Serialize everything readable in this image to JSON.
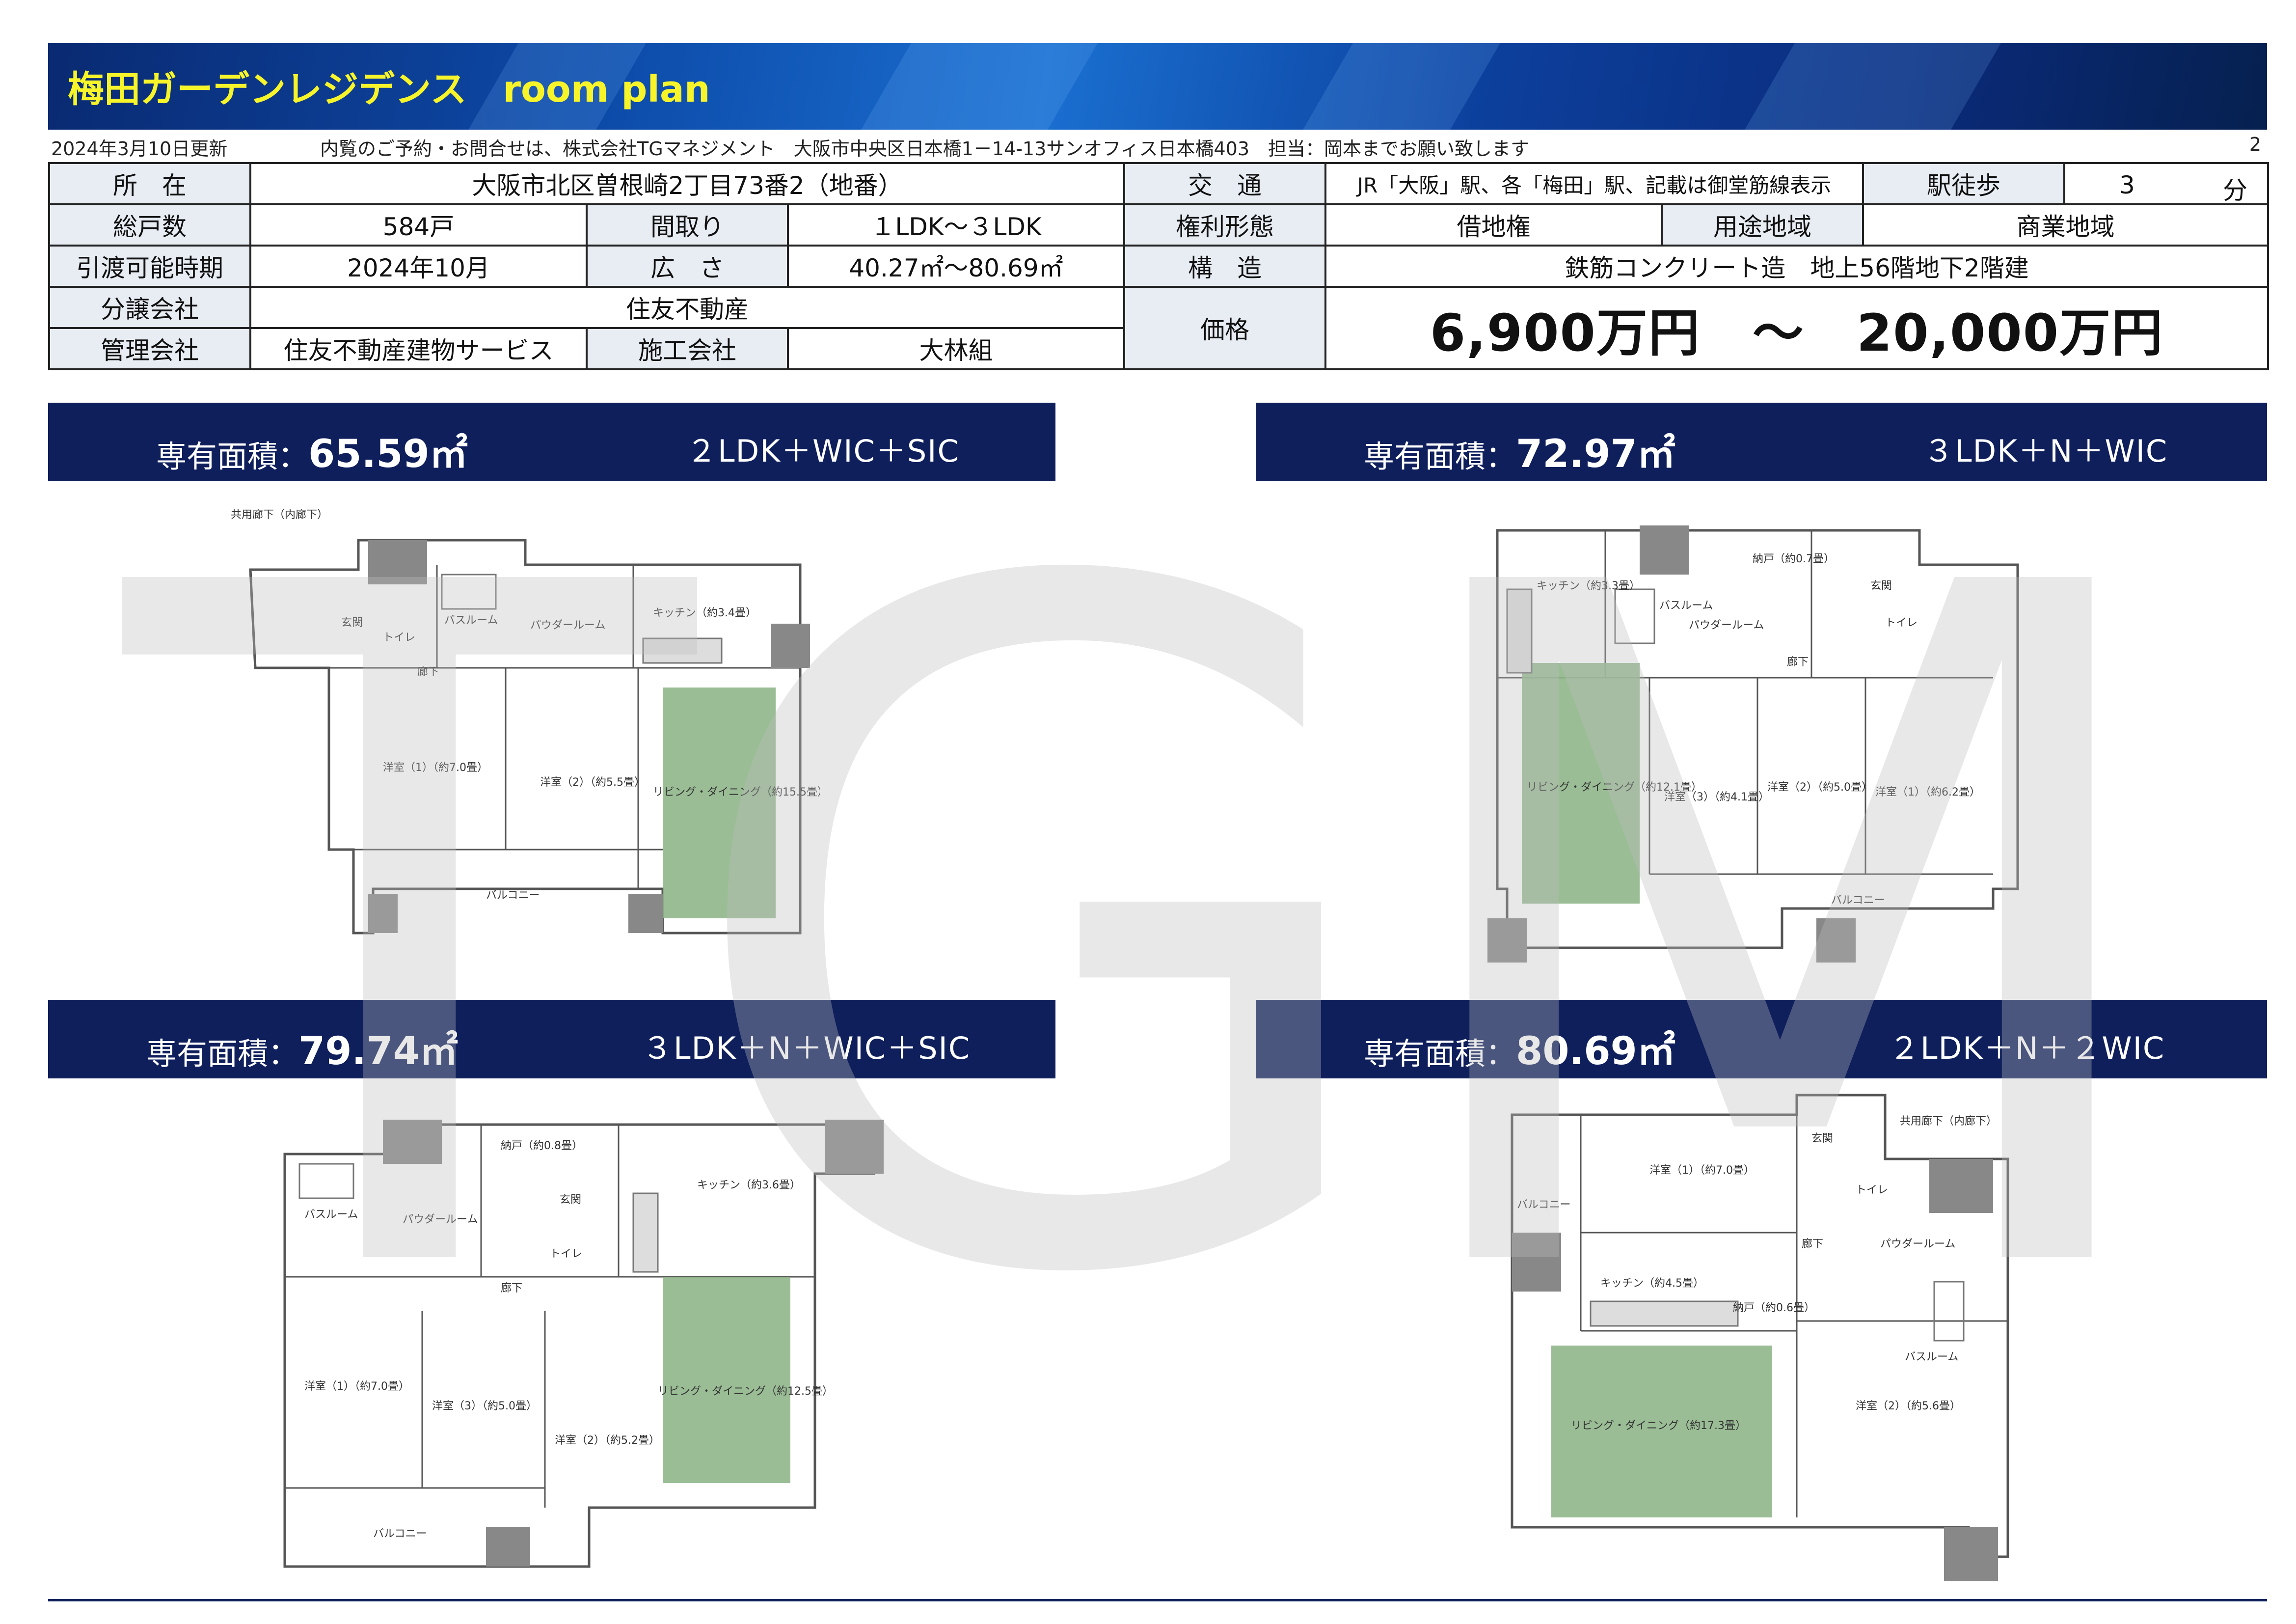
{
  "header": {
    "title": "梅田ガーデンレジデンス　room plan"
  },
  "info_line": {
    "updated": "2024年3月10日更新",
    "contact": "内覧のご予約・お問合せは、株式会社TGマネジメント　大阪市中央区日本橋1－14-13サンオフィス日本橋403　担当：岡本までお願い致します",
    "page": "2"
  },
  "summary": {
    "location_label": "所　在",
    "location": "大阪市北区曽根崎2丁目73番2（地番）",
    "transport_label": "交　通",
    "transport": "JR「大阪」駅、各「梅田」駅、記載は御堂筋線表示",
    "walk_label": "駅徒歩",
    "walk_value": "3",
    "walk_unit": "分",
    "units_label": "総戸数",
    "units": "584戸",
    "layout_label": "間取り",
    "layout": "１LDK～３LDK",
    "rights_label": "権利形態",
    "rights": "借地権",
    "zoning_label": "用途地域",
    "zoning": "商業地域",
    "delivery_label": "引渡可能時期",
    "delivery": "2024年10月",
    "size_label": "広　さ",
    "size": "40.27㎡～80.69㎡",
    "structure_label": "構　造",
    "structure": "鉄筋コンクリート造　地上56階地下2階建",
    "seller_label": "分譲会社",
    "seller": "住友不動産",
    "price_label": "価格",
    "price": "6,900万円　～　20,000万円",
    "manager_label": "管理会社",
    "manager": "住友不動産建物サービス",
    "builder_label": "施工会社",
    "builder": "大林組"
  },
  "plans": [
    {
      "area_label": "専有面積：",
      "area": "65.59㎡",
      "layout": "２LDK＋WIC＋SIC",
      "rooms": [
        "共用廊下（内廊下）",
        "玄関",
        "トイレ",
        "バスルーム",
        "パウダールーム",
        "キッチン（約3.4畳）",
        "廊下",
        "洋室（1）（約7.0畳）",
        "洋室（2）（約5.5畳）",
        "リビング・ダイニング（約15.5畳）",
        "バルコニー"
      ]
    },
    {
      "area_label": "専有面積：",
      "area": "72.97㎡",
      "layout": "３LDK＋N＋WIC",
      "rooms": [
        "キッチン（約3.3畳）",
        "バスルーム",
        "パウダールーム",
        "納戸（約0.7畳）",
        "玄関",
        "トイレ",
        "廊下",
        "リビング・ダイニング（約12.1畳）",
        "洋室（3）（約4.1畳）",
        "洋室（2）（約5.0畳）",
        "洋室（1）（約6.2畳）",
        "バルコニー"
      ]
    },
    {
      "area_label": "専有面積：",
      "area": "79.74㎡",
      "layout": "３LDK＋N＋WIC＋SIC",
      "rooms": [
        "納戸（約0.8畳）",
        "バスルーム",
        "パウダールーム",
        "玄関",
        "キッチン（約3.6畳）",
        "トイレ",
        "廊下",
        "洋室（1）（約7.0畳）",
        "洋室（3）（約5.0畳）",
        "洋室（2）（約5.2畳）",
        "リビング・ダイニング（約12.5畳）",
        "バルコニー"
      ]
    },
    {
      "area_label": "専有面積：",
      "area": "80.69㎡",
      "layout": "２LDK＋N＋２WIC",
      "rooms": [
        "共用廊下（内廊下）",
        "玄関",
        "洋室（1）（約7.0畳）",
        "バルコニー",
        "トイレ",
        "廊下",
        "パウダールーム",
        "キッチン（約4.5畳）",
        "納戸（約0.6畳）",
        "バスルーム",
        "リビング・ダイニング（約17.3畳）",
        "洋室（2）（約5.6畳）"
      ]
    }
  ],
  "watermark": {
    "text": "TGM"
  },
  "colors": {
    "banner": "#0d4aa8",
    "title": "#f7f52a",
    "plan_header": "#0f1f5c",
    "living_green": "#8fb68a",
    "label_cell": "#e8edf4"
  }
}
